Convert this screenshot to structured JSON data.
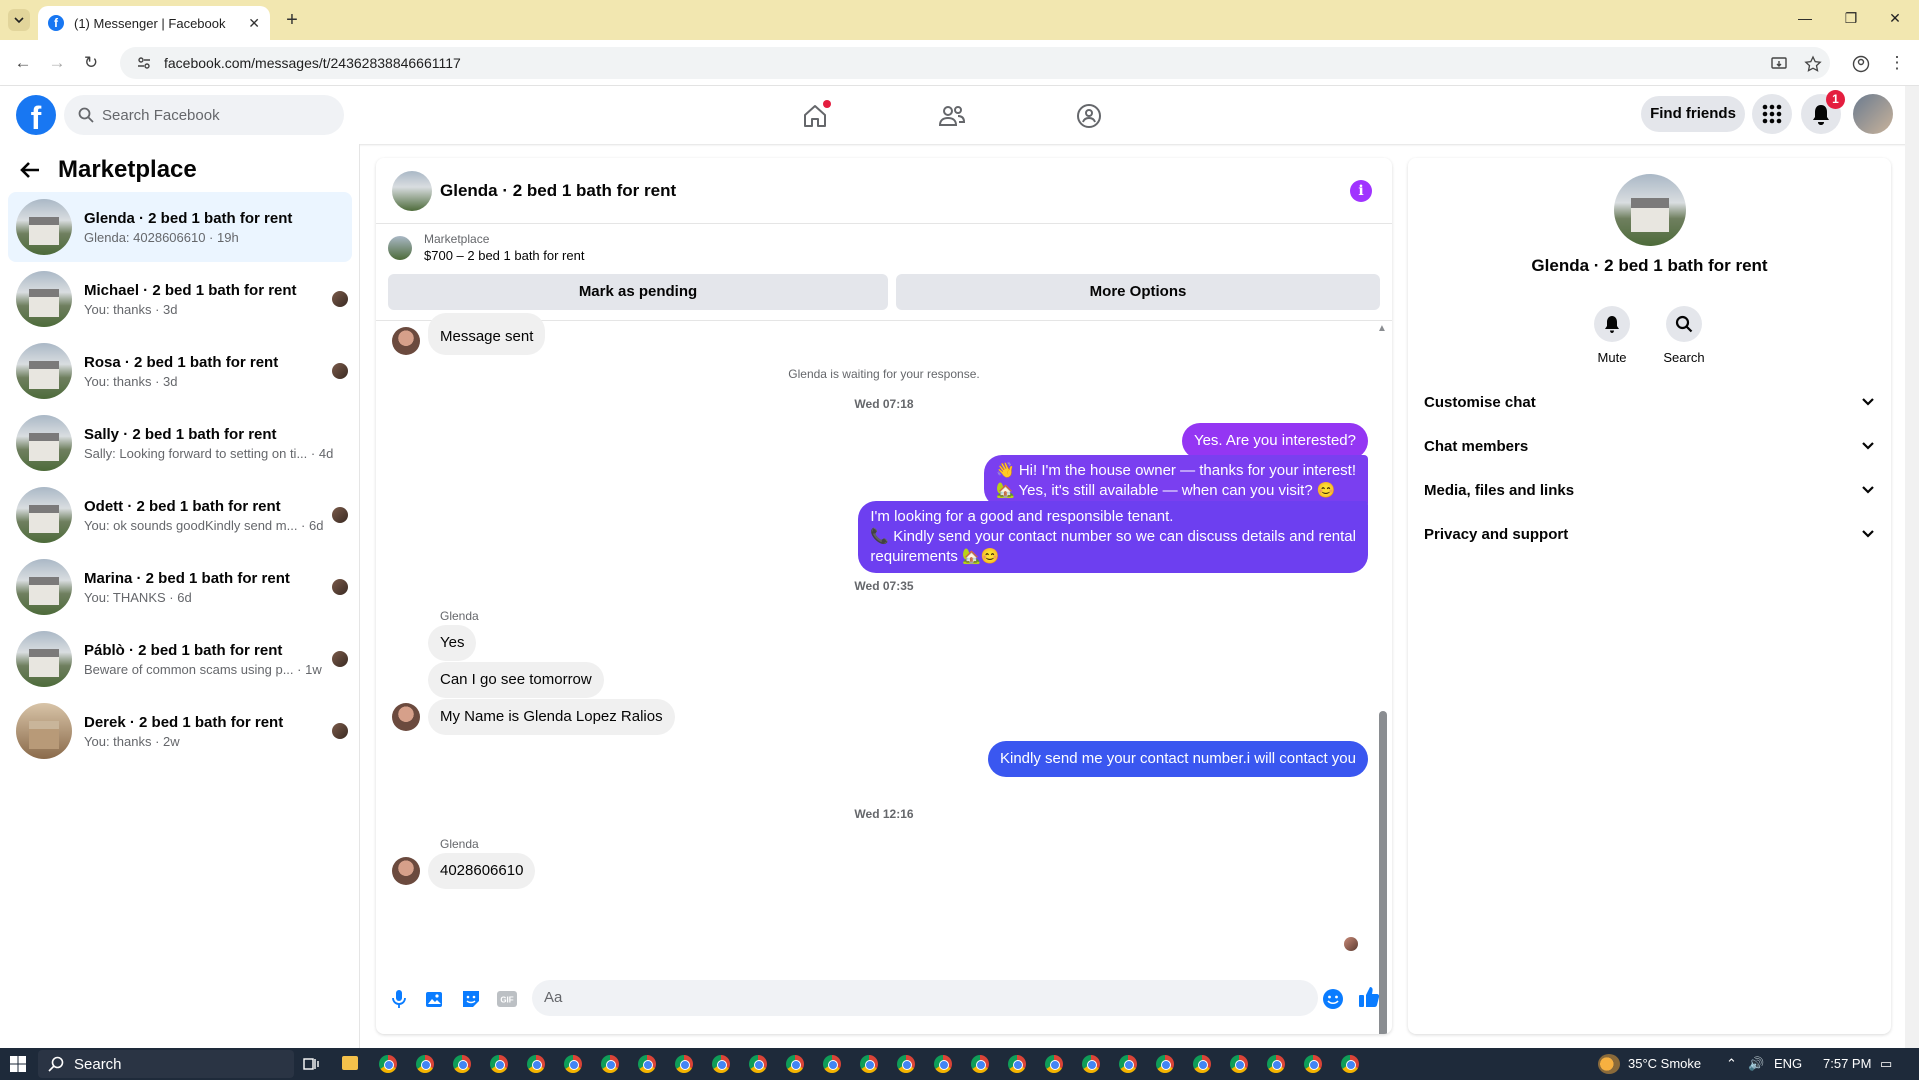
{
  "browser": {
    "tab_title": "(1) Messenger | Facebook",
    "url": "facebook.com/messages/t/24362838846661117"
  },
  "fb_header": {
    "search_placeholder": "Search Facebook",
    "find_friends": "Find friends",
    "notification_count": "1"
  },
  "left_panel": {
    "title": "Marketplace",
    "conversations": [
      {
        "name": "Glenda · 2 bed 1 bath for rent",
        "preview": "Glenda: 4028606610 · 19h"
      },
      {
        "name": "Michael · 2 bed 1 bath for rent",
        "preview": "You: thanks · 3d"
      },
      {
        "name": "Rosa · 2 bed 1 bath for rent",
        "preview": "You: thanks · 3d"
      },
      {
        "name": "Sally · 2 bed 1 bath for rent",
        "preview": "Sally: Looking forward to setting on ti... · 4d"
      },
      {
        "name": "Odett · 2 bed 1 bath for rent",
        "preview": "You: ok sounds goodKindly send m... · 6d"
      },
      {
        "name": "Marina · 2 bed 1 bath for rent",
        "preview": "You: THANKS · 6d"
      },
      {
        "name": "Páblò · 2 bed 1 bath for rent",
        "preview": "Beware of common scams using p... · 1w"
      },
      {
        "name": "Derek · 2 bed 1 bath for rent",
        "preview": "You: thanks · 2w"
      }
    ]
  },
  "chat": {
    "title": "Glenda · 2 bed 1 bath for rent",
    "marketplace_label": "Marketplace",
    "listing": "$700 – 2 bed 1 bath for rent",
    "mark_pending": "Mark as pending",
    "more_options": "More Options",
    "messages": {
      "message_sent": "Message sent",
      "waiting": "Glenda is waiting for your response.",
      "time1": "Wed 07:18",
      "out1": "Yes. Are you interested?",
      "out2a": "👋 Hi! I'm the house owner — thanks for your interest!",
      "out2b": "🏡 Yes, it's still available — when can you visit? 😊",
      "out3a": "I'm looking for a good and responsible tenant.",
      "out3b": "📞 Kindly send your contact number so we can discuss details and rental",
      "out3c": "requirements 🏡😊",
      "time2": "Wed 07:35",
      "sender1": "Glenda",
      "in1": "Yes",
      "in2": "Can I go see tomorrow",
      "in3": "My Name is Glenda Lopez Ralios",
      "out4": "Kindly send me your contact number.i will contact you",
      "time3": "Wed 12:16",
      "sender2": "Glenda",
      "in4": "4028606610"
    },
    "composer_placeholder": "Aa"
  },
  "right_panel": {
    "name": "Glenda · 2 bed 1 bath for rent",
    "mute": "Mute",
    "search": "Search",
    "sections": [
      "Customise chat",
      "Chat members",
      "Media, files and links",
      "Privacy and support"
    ]
  },
  "taskbar": {
    "search": "Search",
    "weather": "35°C  Smoke",
    "lang": "ENG",
    "time": "7:57 PM"
  },
  "colors": {
    "fb_blue": "#1877f2",
    "active_conv": "#ebf5ff",
    "out_bubble_purple": "#9436f3",
    "out_bubble_blue": "#3a57f0",
    "info_purple": "#a033ff"
  }
}
